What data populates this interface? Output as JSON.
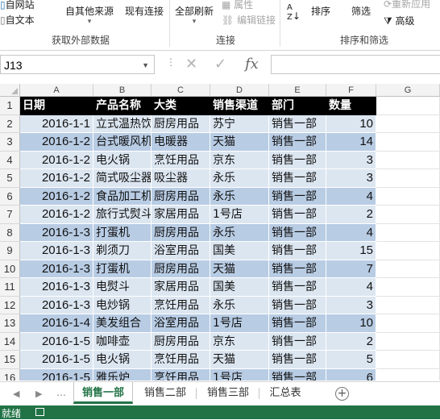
{
  "ribbon": {
    "get_data": {
      "from_web": "自网站",
      "from_text": "自文本",
      "other_sources": "自其他来源",
      "existing": "现有连接",
      "group": "获取外部数据"
    },
    "connections": {
      "refresh_all": "全部刷新",
      "properties": "属性",
      "edit_links": "编辑链接",
      "group": "连接"
    },
    "sort_filter": {
      "sort_icon": "az-sort-icon",
      "sort": "排序",
      "filter": "筛选",
      "reapply": "重新应用",
      "advanced": "高级",
      "group": "排序和筛选"
    }
  },
  "formula_bar": {
    "name_box": "J13",
    "fx": "fx",
    "cancel_icon": "✕",
    "enter_icon": "✓",
    "value": ""
  },
  "columns": [
    "A",
    "B",
    "C",
    "D",
    "E",
    "F",
    "G"
  ],
  "header_row": [
    "日期",
    "产品名称",
    "大类",
    "销售渠道",
    "部门",
    "数量"
  ],
  "rows": [
    [
      "2016-1-1",
      "立式温热饮水机",
      "厨房用品",
      "苏宁",
      "销售一部",
      "10"
    ],
    [
      "2016-1-2",
      "台式暖风机",
      "电暖器",
      "天猫",
      "销售一部",
      "14"
    ],
    [
      "2016-1-2",
      "电火锅",
      "烹饪用品",
      "京东",
      "销售一部",
      "3"
    ],
    [
      "2016-1-2",
      "简式吸尘器",
      "吸尘器",
      "永乐",
      "销售一部",
      "3"
    ],
    [
      "2016-1-2",
      "食品加工机",
      "厨房用品",
      "永乐",
      "销售一部",
      "4"
    ],
    [
      "2016-1-2",
      "旅行式熨斗",
      "家居用品",
      "1号店",
      "销售一部",
      "2"
    ],
    [
      "2016-1-3",
      "打蛋机",
      "厨房用品",
      "永乐",
      "销售一部",
      "4"
    ],
    [
      "2016-1-3",
      "剃须刀",
      "浴室用品",
      "国美",
      "销售一部",
      "15"
    ],
    [
      "2016-1-3",
      "打蛋机",
      "厨房用品",
      "天猫",
      "销售一部",
      "7"
    ],
    [
      "2016-1-3",
      "电熨斗",
      "家居用品",
      "国美",
      "销售一部",
      "4"
    ],
    [
      "2016-1-3",
      "电炒锅",
      "烹饪用品",
      "永乐",
      "销售一部",
      "3"
    ],
    [
      "2016-1-4",
      "美发组合",
      "浴室用品",
      "1号店",
      "销售一部",
      "10"
    ],
    [
      "2016-1-5",
      "咖啡壶",
      "厨房用品",
      "京东",
      "销售一部",
      "2"
    ],
    [
      "2016-1-5",
      "电火锅",
      "烹饪用品",
      "天猫",
      "销售一部",
      "5"
    ],
    [
      "2016-1-5",
      "雅乐炉",
      "烹饪用品",
      "1号店",
      "销售一部",
      "6"
    ]
  ],
  "row_shade": [
    "light",
    "mid",
    "light",
    "light",
    "mid",
    "light",
    "mid",
    "light",
    "mid",
    "light",
    "light",
    "mid",
    "light",
    "light",
    "mid"
  ],
  "sheet_tabs": [
    "销售一部",
    "销售二部",
    "销售三部",
    "汇总表"
  ],
  "active_tab": "销售一部",
  "status": {
    "ready": "就绪"
  },
  "colors": {
    "header_fill": "#000000",
    "light_band": "#dce6f1",
    "mid_band": "#b8cce4",
    "excel_green": "#217346"
  }
}
